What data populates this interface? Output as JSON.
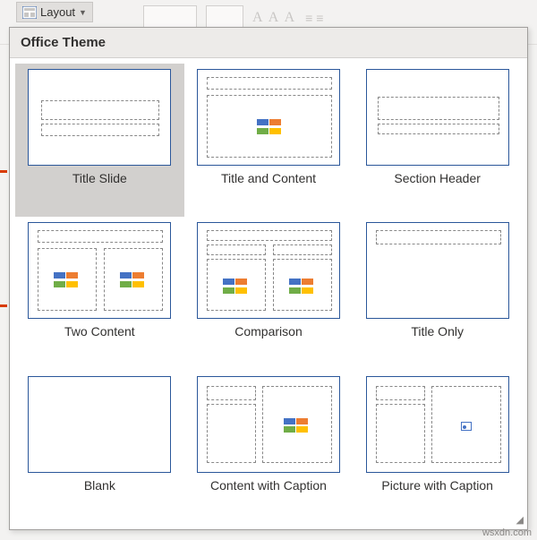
{
  "ribbon": {
    "layout_button_label": "Layout",
    "font_sample": "A A A",
    "bullets_sample": "≡ ≡"
  },
  "gallery": {
    "header": "Office Theme",
    "items": [
      {
        "label": "Title Slide",
        "selected": true
      },
      {
        "label": "Title and Content",
        "selected": false
      },
      {
        "label": "Section Header",
        "selected": false
      },
      {
        "label": "Two Content",
        "selected": false
      },
      {
        "label": "Comparison",
        "selected": false
      },
      {
        "label": "Title Only",
        "selected": false
      },
      {
        "label": "Blank",
        "selected": false
      },
      {
        "label": "Content with Caption",
        "selected": false
      },
      {
        "label": "Picture with Caption",
        "selected": false
      }
    ]
  },
  "watermark": "wsxdn.com"
}
